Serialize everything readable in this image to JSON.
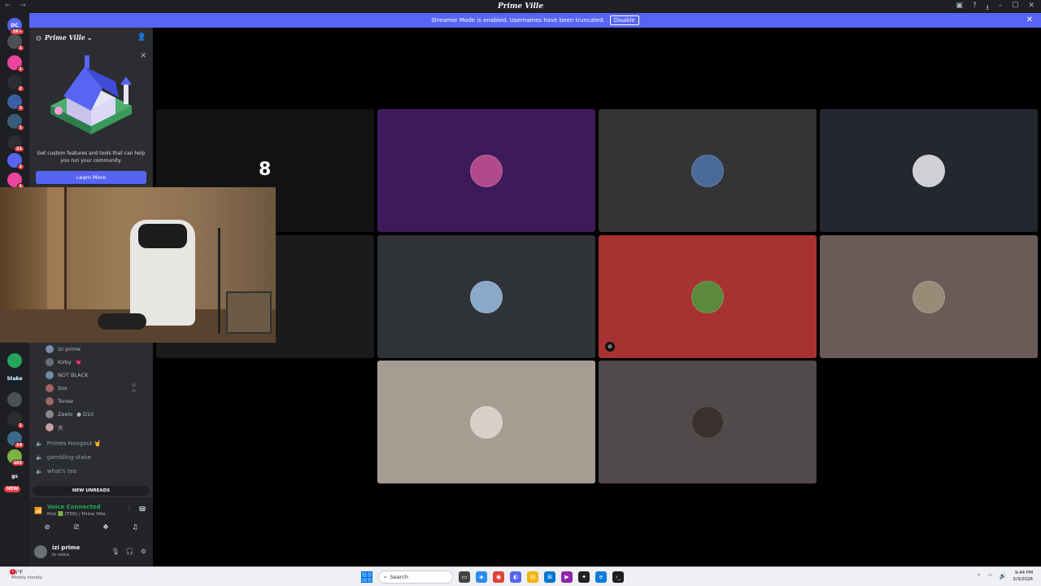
{
  "app": {
    "title": "Prime Ville"
  },
  "window_controls": {
    "minimize": "–",
    "maximize": "☐",
    "close": "✕"
  },
  "banner": {
    "text": "Streamer Mode is enabled. Usernames have been truncated.",
    "button": "Disable"
  },
  "server_rail": [
    {
      "label": "DC",
      "badge": "1K+",
      "color": "#5865f2"
    },
    {
      "label": "",
      "badge": "1",
      "color": "#4e5058"
    },
    {
      "label": "",
      "badge": "1",
      "color": "#eb459e"
    },
    {
      "label": "",
      "badge": "2",
      "color": "#2b2d31"
    },
    {
      "label": "",
      "badge": "3",
      "color": "#3c5fa8"
    },
    {
      "label": "",
      "badge": "1",
      "color": "#3a5c7a"
    },
    {
      "label": "",
      "badge": "21",
      "color": "#2b2d31"
    },
    {
      "label": "",
      "badge": "1",
      "color": "#5865f2"
    },
    {
      "label": "",
      "badge": "1",
      "color": "#eb459e"
    },
    {
      "label": "",
      "badge": "",
      "color": "#23a55a"
    },
    {
      "label": "Stake",
      "badge": "",
      "color": "#0f212e"
    },
    {
      "label": "",
      "badge": "",
      "color": "#4e5058"
    },
    {
      "label": "",
      "badge": "1",
      "color": "#2b2d31"
    },
    {
      "label": "",
      "badge": "14",
      "color": "#3a6a8a"
    },
    {
      "label": "",
      "badge": "103",
      "color": "#7cb342"
    },
    {
      "label": "gs",
      "badge": "",
      "color": "#1e1f22"
    }
  ],
  "sidebar": {
    "server_name": "Prime Ville",
    "promo": {
      "text": "Get custom features and tools that can help you run your community.",
      "button": "Learn More"
    },
    "members": [
      {
        "name": "izi prime",
        "extra": ""
      },
      {
        "name": "Kirby",
        "extra": "💗"
      },
      {
        "name": "NOT BLACK",
        "extra": ""
      },
      {
        "name": "Sos",
        "extra": ""
      },
      {
        "name": "Tonee",
        "extra": ""
      },
      {
        "name": "Zeelo",
        "extra": "● D10"
      },
      {
        "name": "天",
        "extra": ""
      }
    ],
    "channels": [
      {
        "name": "Primes Hangout 🤘"
      },
      {
        "name": "gambling-stake"
      },
      {
        "name": "what's tea"
      }
    ],
    "new_unreads": "NEW UNREADS",
    "new_pill": "NEW"
  },
  "voice": {
    "status": "Voice Connected",
    "channel": "Kick 🟩 (TOS) / Prime Ville"
  },
  "user": {
    "name": "izi prime",
    "status": "In voice"
  },
  "tiles": [
    {
      "color": "#111214"
    },
    {
      "color": "#3d1a5c"
    },
    {
      "color": "#333435"
    },
    {
      "color": "#25272f"
    },
    {
      "color": "#1b1b1c"
    },
    {
      "color": "#2f3236"
    },
    {
      "color": "#a83232"
    },
    {
      "color": "#6a5a58"
    },
    {
      "color": "#a69c92"
    },
    {
      "color": "#514a4a"
    }
  ],
  "taskbar": {
    "weather_temp": "55°F",
    "weather_cond": "Mostly cloudy",
    "weather_badge": "1",
    "search_placeholder": "Search",
    "time": "9:44 PM",
    "date": "3/3/2026"
  }
}
